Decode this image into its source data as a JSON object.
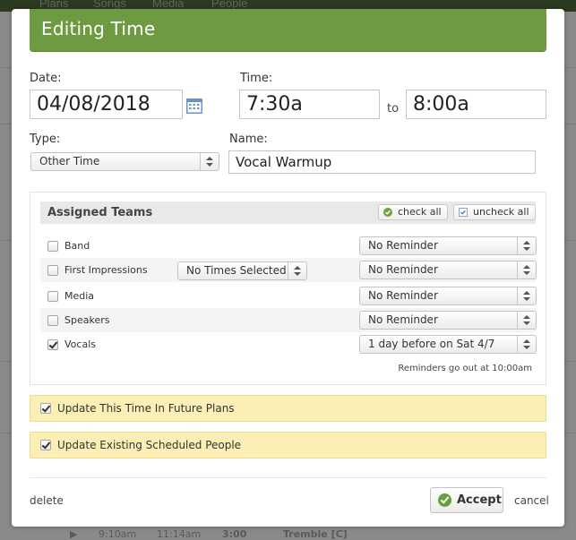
{
  "background": {
    "nav_tabs": [
      "Plans",
      "Songs",
      "Media",
      "People"
    ],
    "bottom_row": [
      "9:10am",
      "11:14am",
      "3:00",
      "Tremble [C]"
    ]
  },
  "modal": {
    "title": "Editing Time",
    "date_label": "Date:",
    "date_value": "04/08/2018",
    "time_label": "Time:",
    "time_start": "7:30a",
    "to_label": "to",
    "time_end": "8:00a",
    "type_label": "Type:",
    "type_value": "Other Time",
    "name_label": "Name:",
    "name_value": "Vocal Warmup"
  },
  "teams": {
    "title": "Assigned Teams",
    "check_all": "check all",
    "uncheck_all": "uncheck all",
    "rows": [
      {
        "name": "Band",
        "checked": false,
        "times": null,
        "reminder": "No Reminder"
      },
      {
        "name": "First Impressions",
        "checked": false,
        "times": "No Times Selected",
        "reminder": "No Reminder"
      },
      {
        "name": "Media",
        "checked": false,
        "times": null,
        "reminder": "No Reminder"
      },
      {
        "name": "Speakers",
        "checked": false,
        "times": null,
        "reminder": "No Reminder"
      },
      {
        "name": "Vocals",
        "checked": true,
        "times": null,
        "reminder": "1 day before on Sat 4/7"
      }
    ],
    "reminder_note": "Reminders go out at 10:00am"
  },
  "options": {
    "update_future": "Update This Time In Future Plans",
    "update_scheduled": "Update Existing Scheduled People"
  },
  "footer": {
    "delete": "delete",
    "accept": "Accept",
    "cancel": "cancel"
  },
  "colors": {
    "header_green": "#6e9a42",
    "yellow_bar": "#fbefb6",
    "accept_icon": "#64a13a"
  }
}
